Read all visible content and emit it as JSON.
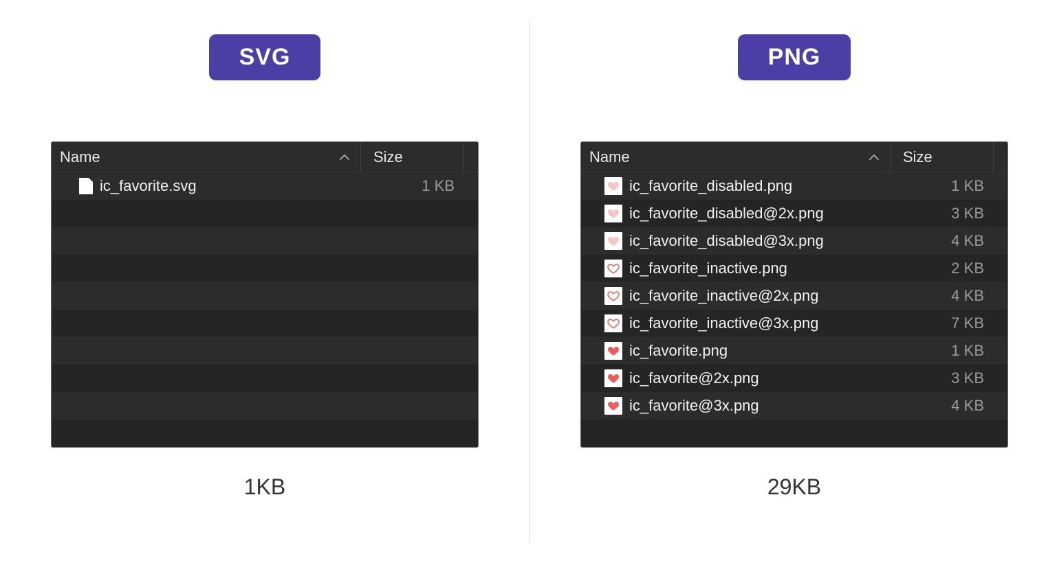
{
  "left": {
    "badge": "SVG",
    "header": {
      "name": "Name",
      "size": "Size"
    },
    "rows": [
      {
        "icon": "doc",
        "name": "ic_favorite.svg",
        "size": "1 KB"
      }
    ],
    "emptyRows": 9,
    "total": "1KB"
  },
  "right": {
    "badge": "PNG",
    "header": {
      "name": "Name",
      "size": "Size"
    },
    "rows": [
      {
        "icon": "heart-light",
        "name": "ic_favorite_disabled.png",
        "size": "1 KB"
      },
      {
        "icon": "heart-light",
        "name": "ic_favorite_disabled@2x.png",
        "size": "3 KB"
      },
      {
        "icon": "heart-light",
        "name": "ic_favorite_disabled@3x.png",
        "size": "4 KB"
      },
      {
        "icon": "heart-outline",
        "name": "ic_favorite_inactive.png",
        "size": "2 KB"
      },
      {
        "icon": "heart-outline",
        "name": "ic_favorite_inactive@2x.png",
        "size": "4 KB"
      },
      {
        "icon": "heart-outline",
        "name": "ic_favorite_inactive@3x.png",
        "size": "7 KB"
      },
      {
        "icon": "heart-solid",
        "name": "ic_favorite.png",
        "size": "1 KB"
      },
      {
        "icon": "heart-solid",
        "name": "ic_favorite@2x.png",
        "size": "3 KB"
      },
      {
        "icon": "heart-solid",
        "name": "ic_favorite@3x.png",
        "size": "4 KB"
      }
    ],
    "emptyRows": 1,
    "total": "29KB"
  },
  "colors": {
    "badgeBg": "#4b3fa6",
    "heartSolid": "#f15b5b",
    "heartLight": "#f9c4c4"
  }
}
